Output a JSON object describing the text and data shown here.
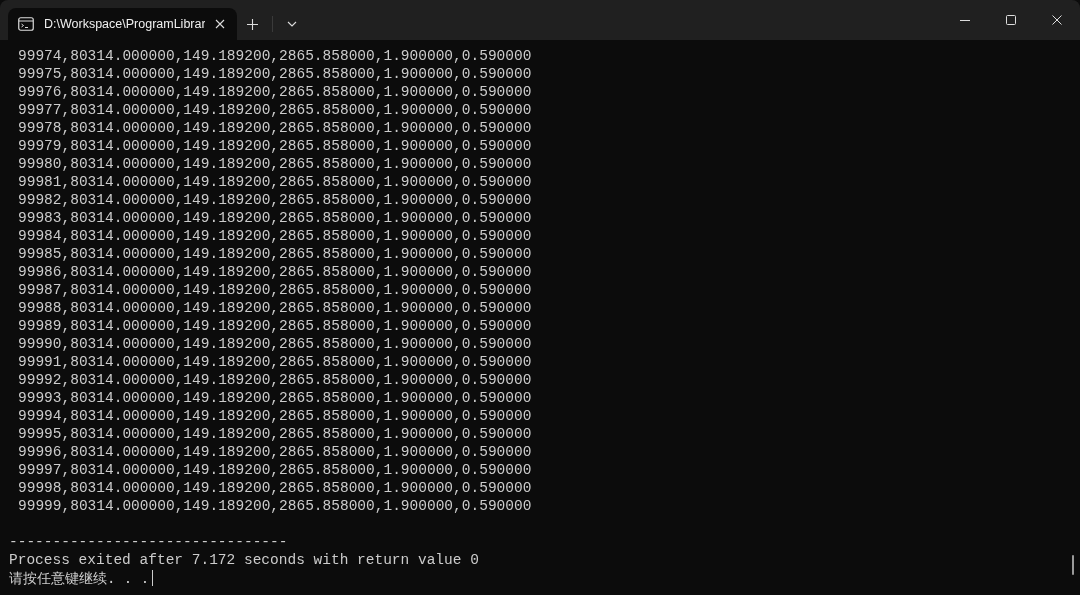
{
  "tab": {
    "title": "D:\\Workspace\\ProgramLibrar",
    "selected": true
  },
  "output_lines": [
    "99974,80314.000000,149.189200,2865.858000,1.900000,0.590000",
    "99975,80314.000000,149.189200,2865.858000,1.900000,0.590000",
    "99976,80314.000000,149.189200,2865.858000,1.900000,0.590000",
    "99977,80314.000000,149.189200,2865.858000,1.900000,0.590000",
    "99978,80314.000000,149.189200,2865.858000,1.900000,0.590000",
    "99979,80314.000000,149.189200,2865.858000,1.900000,0.590000",
    "99980,80314.000000,149.189200,2865.858000,1.900000,0.590000",
    "99981,80314.000000,149.189200,2865.858000,1.900000,0.590000",
    "99982,80314.000000,149.189200,2865.858000,1.900000,0.590000",
    "99983,80314.000000,149.189200,2865.858000,1.900000,0.590000",
    "99984,80314.000000,149.189200,2865.858000,1.900000,0.590000",
    "99985,80314.000000,149.189200,2865.858000,1.900000,0.590000",
    "99986,80314.000000,149.189200,2865.858000,1.900000,0.590000",
    "99987,80314.000000,149.189200,2865.858000,1.900000,0.590000",
    "99988,80314.000000,149.189200,2865.858000,1.900000,0.590000",
    "99989,80314.000000,149.189200,2865.858000,1.900000,0.590000",
    "99990,80314.000000,149.189200,2865.858000,1.900000,0.590000",
    "99991,80314.000000,149.189200,2865.858000,1.900000,0.590000",
    "99992,80314.000000,149.189200,2865.858000,1.900000,0.590000",
    "99993,80314.000000,149.189200,2865.858000,1.900000,0.590000",
    "99994,80314.000000,149.189200,2865.858000,1.900000,0.590000",
    "99995,80314.000000,149.189200,2865.858000,1.900000,0.590000",
    "99996,80314.000000,149.189200,2865.858000,1.900000,0.590000",
    "99997,80314.000000,149.189200,2865.858000,1.900000,0.590000",
    "99998,80314.000000,149.189200,2865.858000,1.900000,0.590000",
    "99999,80314.000000,149.189200,2865.858000,1.900000,0.590000"
  ],
  "separator": "--------------------------------",
  "exit_message": "Process exited after 7.172 seconds with return value 0",
  "prompt": "请按任意键继续. . ."
}
